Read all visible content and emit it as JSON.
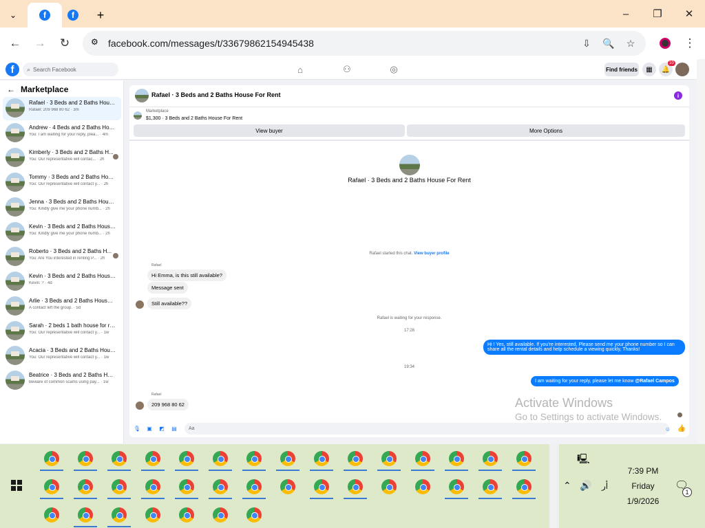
{
  "browser": {
    "url": "facebook.com/messages/t/33679862154945438"
  },
  "fb": {
    "search_placeholder": "Search Facebook",
    "find_friends": "Find friends",
    "notifications_count": "10"
  },
  "sidebar": {
    "title": "Marketplace",
    "conversations": [
      {
        "title": "Rafael · 3 Beds and 2 Baths House ...",
        "preview": "Rafael: 209 968 80 62 · 3m",
        "selected": true
      },
      {
        "title": "Andrew · 4 Beds and 2 Baths Hous...",
        "preview": "You: I am waiting for your reply, plea... · 4m"
      },
      {
        "title": "Kimberly · 3 Beds and 2 Baths H...",
        "preview": "You: Our representative will contac... · 2h"
      },
      {
        "title": "Tommy · 3 Beds and 2 Baths Hous...",
        "preview": "You: Our representative will contact y... · 2h"
      },
      {
        "title": "Jenna · 3 Beds and 2 Baths House ...",
        "preview": "You: Kindly give me your phone numb... · 2h"
      },
      {
        "title": "Kevin · 3 Beds and 2 Baths House ...",
        "preview": "You: Kindly give me your phone numb... · 2h"
      },
      {
        "title": "Roberto · 3 Beds and 2 Baths H...",
        "preview": "You: Are You interested in renting P... · 2h"
      },
      {
        "title": "Kevin · 3 Beds and 2 Baths House ...",
        "preview": "Kevin: ? · 4d"
      },
      {
        "title": "Arlie · 3 Beds and 2 Baths House F...",
        "preview": "A contact left the group. · 5d"
      },
      {
        "title": "Sarah · 2 beds 1 bath house for rent",
        "preview": "You: Our representative will contact y... · 1w"
      },
      {
        "title": "Acacia · 3 Beds and 2 Baths House...",
        "preview": "You: Our representative will contact y... · 1w"
      },
      {
        "title": "Beatrice · 3 Beds and 2 Baths Hous...",
        "preview": "Beware of common scams using pay... · 1w"
      }
    ]
  },
  "chat": {
    "header_title": "Rafael · 3 Beds and 2 Baths House For Rent",
    "marketplace_label": "Marketplace",
    "listing_line": "$1,300 · 3 Beds and 2 Baths House For Rent",
    "view_buyer": "View buyer",
    "more_options": "More Options",
    "center_title": "Rafael · 3 Beds and 2 Baths House For Rent",
    "started_text": "Rafael started this chat.",
    "view_buyer_profile": "View buyer profile",
    "sender_name": "Rafael",
    "msg1": "Hi Emma, is this still available?",
    "msg2": "Message sent",
    "msg3": "Still available??",
    "waiting_text": "Rafael is waiting for your response.",
    "time1": "17:28",
    "out1": "Hi ! Yes, still available. If you're interested, Please send me your phone number so I can share all the rental details and help schedule a viewing quickly, Thanks!",
    "time2": "19:34",
    "out2_prefix": "I am waiting for your reply, please let me know ",
    "out2_mention": "@Rafael Campos",
    "sender_name2": "Rafael",
    "msg4": "209 968 80 62",
    "composer_placeholder": "Aa"
  },
  "watermark": {
    "line1": "Activate Windows",
    "line2": "Go to Settings to activate Windows."
  },
  "tray": {
    "time": "7:39 PM",
    "day": "Friday",
    "date": "1/9/2026",
    "lang": "أر",
    "notif_count": "1"
  }
}
